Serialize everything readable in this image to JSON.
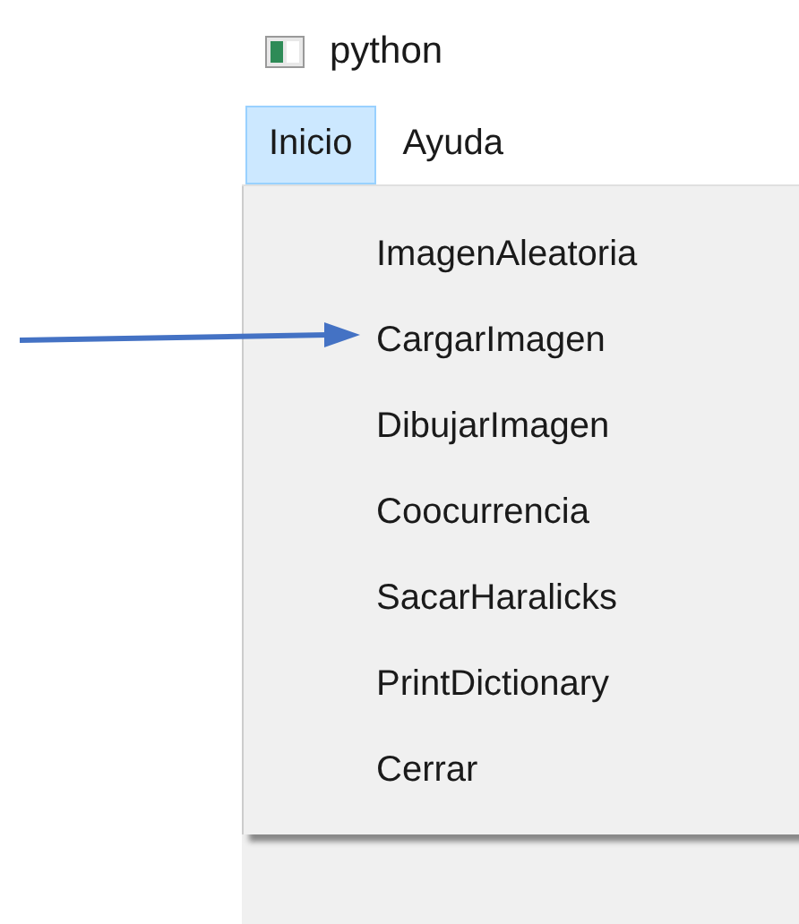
{
  "window": {
    "title": "python"
  },
  "menu_bar": [
    {
      "label": "Inicio",
      "selected": true
    },
    {
      "label": "Ayuda",
      "selected": false
    }
  ],
  "menu": {
    "items": [
      {
        "label": "ImagenAleatoria",
        "marked": false
      },
      {
        "label": "CargarImagen",
        "marked": true
      },
      {
        "label": "DibujarImagen",
        "marked": false
      },
      {
        "label": "Coocurrencia",
        "marked": false
      },
      {
        "label": "SacarHaralicks",
        "marked": false
      },
      {
        "label": "PrintDictionary",
        "marked": false
      },
      {
        "label": "Cerrar",
        "marked": false
      }
    ]
  }
}
